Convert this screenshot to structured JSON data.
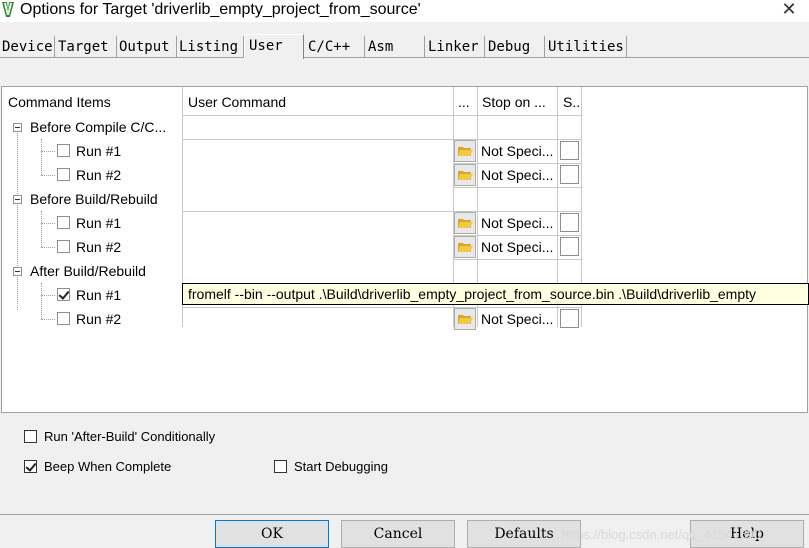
{
  "window": {
    "title": "Options for Target 'driverlib_empty_project_from_source'",
    "close_glyph": "✕",
    "icon": "keil-app-icon"
  },
  "tabs": [
    {
      "label": "Device"
    },
    {
      "label": "Target"
    },
    {
      "label": "Output"
    },
    {
      "label": "Listing"
    },
    {
      "label": "User"
    },
    {
      "label": "C/C++"
    },
    {
      "label": "Asm"
    },
    {
      "label": "Linker"
    },
    {
      "label": "Debug"
    },
    {
      "label": "Utilities"
    }
  ],
  "grid": {
    "headers": {
      "items": "Command Items",
      "command": "User Command",
      "browse": "...",
      "stop": "Stop on ...",
      "s": "S.."
    },
    "groups": [
      {
        "label": "Before Compile C/C...",
        "runs": [
          {
            "label": "Run #1",
            "checked": false,
            "command": "",
            "stop": "Not Speci..."
          },
          {
            "label": "Run #2",
            "checked": false,
            "command": "",
            "stop": "Not Speci..."
          }
        ]
      },
      {
        "label": "Before Build/Rebuild",
        "runs": [
          {
            "label": "Run #1",
            "checked": false,
            "command": "",
            "stop": "Not Speci..."
          },
          {
            "label": "Run #2",
            "checked": false,
            "command": "",
            "stop": "Not Speci..."
          }
        ]
      },
      {
        "label": "After Build/Rebuild",
        "runs": [
          {
            "label": "Run #1",
            "checked": true,
            "command": "fromelf --bin --output .\\Build\\driverlib_empty_project_from_source.bin .\\Build\\driverlib_empty",
            "stop": ""
          },
          {
            "label": "Run #2",
            "checked": false,
            "command": "",
            "stop": "Not Speci..."
          }
        ]
      }
    ],
    "tooltip": "fromelf --bin --output .\\Build\\driverlib_empty_project_from_source.bin .\\Build\\driverlib_empty"
  },
  "options": {
    "run_after_build_conditionally": {
      "label": "Run 'After-Build' Conditionally",
      "checked": false
    },
    "beep_when_complete": {
      "label": "Beep When Complete",
      "checked": true
    },
    "start_debugging": {
      "label": "Start Debugging",
      "checked": false
    }
  },
  "buttons": {
    "ok": "OK",
    "cancel": "Cancel",
    "defaults": "Defaults",
    "help": "Help"
  },
  "watermark": "https://blog.csdn.net/qq_41541690"
}
